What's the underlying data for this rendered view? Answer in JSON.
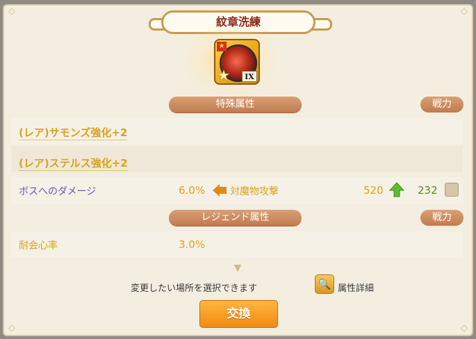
{
  "window": {
    "title": "紋章洗練"
  },
  "emblem": {
    "rank": "IX",
    "icon": "crest-emblem-icon"
  },
  "special": {
    "section_label": "特殊属性",
    "power_label": "戦力",
    "lines": [
      {
        "text": "(レア)サモンズ強化+2"
      },
      {
        "text": "(レア)ステルス強化+2"
      }
    ],
    "stat": {
      "label": "ボスへのダメージ",
      "value": "6.0%",
      "new_label": "対魔物攻撃",
      "new_power": "520",
      "current_power": "232"
    }
  },
  "legend": {
    "section_label": "レジェンド属性",
    "power_label": "戦力",
    "stat": {
      "label": "耐会心率",
      "value": "3.0%"
    }
  },
  "footer": {
    "hint": "変更したい場所を選択できます",
    "detail_label": "属性詳細",
    "exchange_label": "交換"
  },
  "colors": {
    "accent_gold": "#d9a21f",
    "section_pill": "#c98a5e",
    "purple_label": "#6d58b0",
    "power_green": "#5a8a24",
    "exchange_orange": "#f39a1c"
  }
}
